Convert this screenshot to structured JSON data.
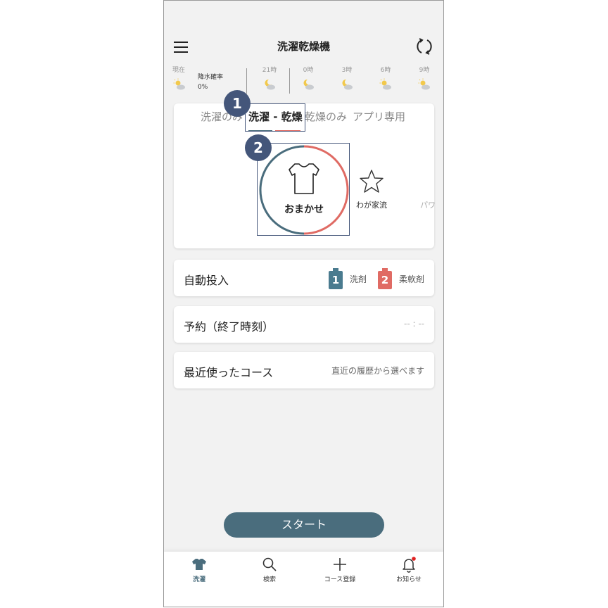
{
  "header": {
    "title": "洗濯乾燥機"
  },
  "weather": {
    "now_label": "現在",
    "rain_label": "降水確率",
    "rain_value": "0%",
    "hours": [
      "21時",
      "0時",
      "3時",
      "6時",
      "9時"
    ]
  },
  "courses": {
    "tabs": [
      "洗濯のみ",
      "洗濯 - 乾燥",
      "乾燥のみ",
      "アプリ専用"
    ],
    "active_tab": "洗濯 - 乾燥",
    "selected": "おまかせ",
    "second": "わが家流",
    "third_partial": "パワ",
    "badge1": "1",
    "badge2": "2"
  },
  "auto_dose": {
    "label": "自動投入",
    "tank1_num": "1",
    "tank1_label": "洗剤",
    "tank2_num": "2",
    "tank2_label": "柔軟剤"
  },
  "reservation": {
    "label": "予約（終了時刻）",
    "value": "-- : --"
  },
  "recent": {
    "label": "最近使ったコース",
    "hint": "直近の履歴から選べます"
  },
  "start_label": "スタート",
  "nav": [
    "洗濯",
    "検索",
    "コース登録",
    "お知らせ"
  ],
  "colors": {
    "accent": "#4a6d7d",
    "dry": "#e06b64",
    "badge": "#44567a"
  }
}
